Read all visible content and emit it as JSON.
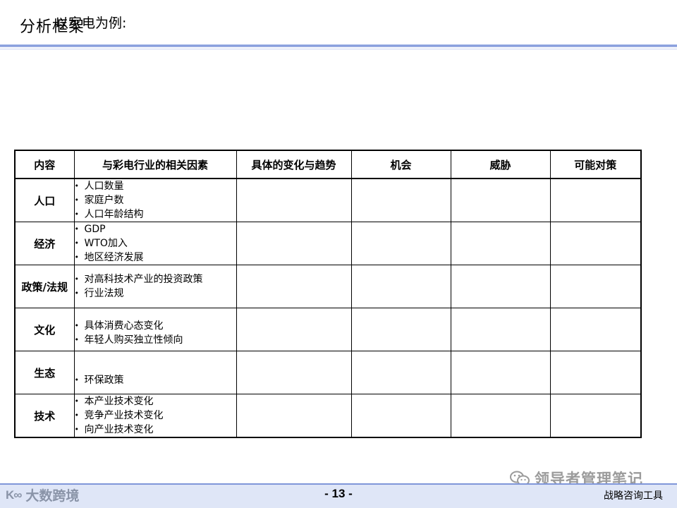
{
  "header": {
    "title": "分析框架",
    "subtitle": "以家电为例:"
  },
  "table": {
    "columns": [
      "内容",
      "与彩电行业的相关因素",
      "具体的变化与趋势",
      "机会",
      "威胁",
      "可能对策"
    ],
    "rows": [
      {
        "category": "人口",
        "factors": [
          "人口数量",
          "家庭户数",
          "人口年龄结构"
        ]
      },
      {
        "category": "经济",
        "factors": [
          "GDP",
          "WTO加入",
          "地区经济发展"
        ]
      },
      {
        "category": "政策/法规",
        "factors": [
          "对高科技术产业的投资政策",
          "行业法规"
        ]
      },
      {
        "category": "文化",
        "factors": [
          "具体消费心态变化",
          "年轻人购买独立性倾向"
        ]
      },
      {
        "category": "生态",
        "factors": [
          "环保政策"
        ]
      },
      {
        "category": "技术",
        "factors": [
          "本产业技术变化",
          "竞争产业技术变化",
          "向产业技术变化"
        ]
      }
    ]
  },
  "footer": {
    "page_number": "- 13 -",
    "right_label": "战略咨询工具",
    "logo_mark": "K∞",
    "logo_text": "大数跨境",
    "watermark_text": "领导者管理笔记"
  },
  "icons": {
    "logo": "brand-logo-icon",
    "watermark": "wechat-icon"
  },
  "colors": {
    "accent": "#7f96d9",
    "footer_bg": "#dfe6f7"
  }
}
